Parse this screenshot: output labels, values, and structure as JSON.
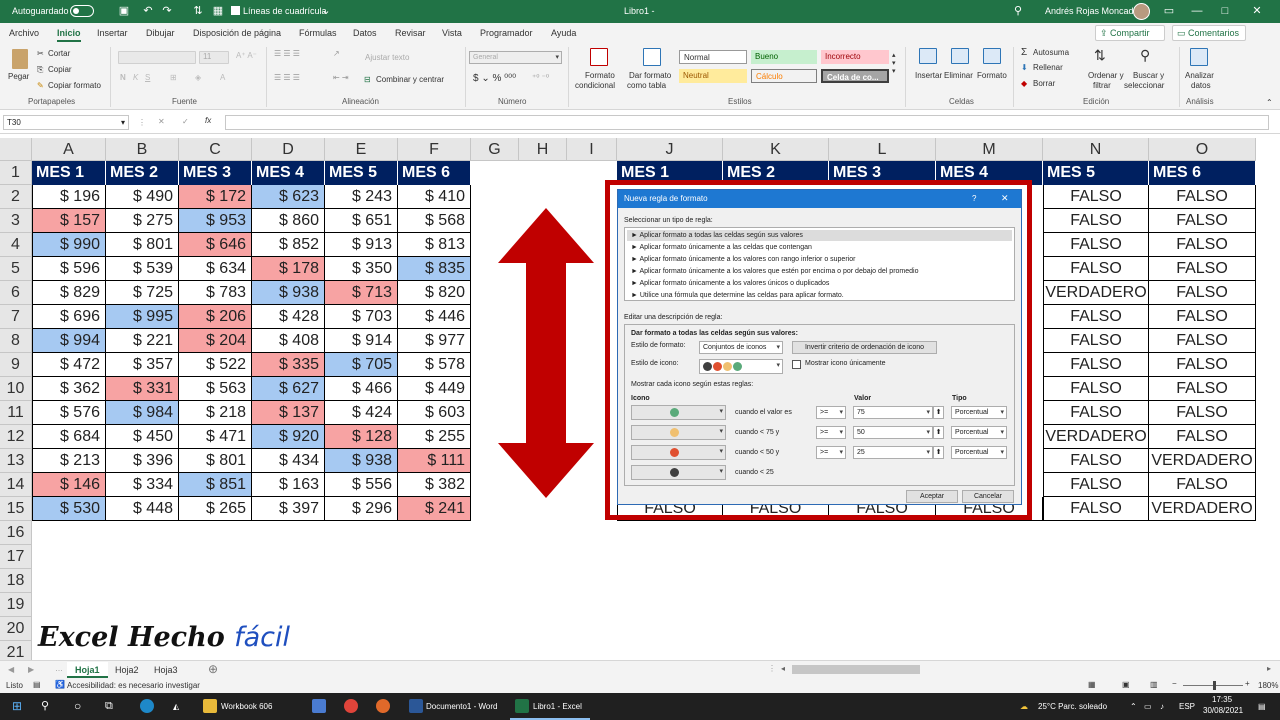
{
  "titlebar": {
    "autosave": "Autoguardado",
    "gridlines": "Líneas de cuadrícula",
    "doc": "Libro1 -",
    "user": "Andrés Rojas Moncada"
  },
  "menu": {
    "tabs": [
      "Archivo",
      "Inicio",
      "Insertar",
      "Dibujar",
      "Disposición de página",
      "Fórmulas",
      "Datos",
      "Revisar",
      "Vista",
      "Programador",
      "Ayuda"
    ],
    "share": "Compartir",
    "comments": "Comentarios"
  },
  "ribbon": {
    "portapapeles": {
      "paste": "Pegar",
      "cut": "Cortar",
      "copy": "Copiar",
      "format": "Copiar formato",
      "group": "Portapapeles"
    },
    "fuente": {
      "group": "Fuente",
      "size": "11"
    },
    "alineacion": {
      "wrap": "Ajustar texto",
      "merge": "Combinar y centrar",
      "group": "Alineación"
    },
    "numero": {
      "format": "General",
      "group": "Número"
    },
    "estilos": {
      "cond1": "Formato",
      "cond2": "condicional",
      "tbl1": "Dar formato",
      "tbl2": "como tabla",
      "normal": "Normal",
      "bueno": "Bueno",
      "incorrecto": "Incorrecto",
      "neutral": "Neutral",
      "calculo": "Cálculo",
      "celda": "Celda de co...",
      "group": "Estilos"
    },
    "celdas": {
      "insert": "Insertar",
      "delete": "Eliminar",
      "format": "Formato",
      "group": "Celdas"
    },
    "edicion": {
      "autosum": "Autosuma",
      "fill": "Rellenar",
      "clear": "Borrar",
      "sort1": "Ordenar y",
      "sort2": "filtrar",
      "find1": "Buscar y",
      "find2": "seleccionar",
      "group": "Edición"
    },
    "analisis": {
      "l1": "Analizar",
      "l2": "datos",
      "group": "Análisis"
    }
  },
  "formula": {
    "namebox": "T30",
    "fx": "fx"
  },
  "columns": [
    "A",
    "B",
    "C",
    "D",
    "E",
    "F",
    "G",
    "H",
    "I",
    "J",
    "K",
    "L",
    "M",
    "N",
    "O"
  ],
  "rows": [
    "1",
    "2",
    "3",
    "4",
    "5",
    "6",
    "7",
    "8",
    "9",
    "10",
    "11",
    "12",
    "13",
    "14",
    "15",
    "16",
    "17",
    "18",
    "19",
    "20",
    "21"
  ],
  "left_headers": [
    "MES 1",
    "MES 2",
    "MES 3",
    "MES 4",
    "MES 5",
    "MES 6"
  ],
  "right_headers": [
    "MES 1",
    "MES 2",
    "MES 3",
    "MES 4",
    "MES 5",
    "MES 6"
  ],
  "left_values": [
    [
      "$ 196",
      "$ 490",
      "$ 172",
      "$ 623",
      "$ 243",
      "$ 410"
    ],
    [
      "$ 157",
      "$ 275",
      "$ 953",
      "$ 860",
      "$ 651",
      "$ 568"
    ],
    [
      "$ 990",
      "$ 801",
      "$ 646",
      "$ 852",
      "$ 913",
      "$ 813"
    ],
    [
      "$ 596",
      "$ 539",
      "$ 634",
      "$ 178",
      "$ 350",
      "$ 835"
    ],
    [
      "$ 829",
      "$ 725",
      "$ 783",
      "$ 938",
      "$ 713",
      "$ 820"
    ],
    [
      "$ 696",
      "$ 995",
      "$ 206",
      "$ 428",
      "$ 703",
      "$ 446"
    ],
    [
      "$ 994",
      "$ 221",
      "$ 204",
      "$ 408",
      "$ 914",
      "$ 977"
    ],
    [
      "$ 472",
      "$ 357",
      "$ 522",
      "$ 335",
      "$ 705",
      "$ 578"
    ],
    [
      "$ 362",
      "$ 331",
      "$ 563",
      "$ 627",
      "$ 466",
      "$ 449"
    ],
    [
      "$ 576",
      "$ 984",
      "$ 218",
      "$ 137",
      "$ 424",
      "$ 603"
    ],
    [
      "$ 684",
      "$ 450",
      "$ 471",
      "$ 920",
      "$ 128",
      "$ 255"
    ],
    [
      "$ 213",
      "$ 396",
      "$ 801",
      "$ 434",
      "$ 938",
      "$ 111"
    ],
    [
      "$ 146",
      "$ 334",
      "$ 851",
      "$ 163",
      "$ 556",
      "$ 382"
    ],
    [
      "$ 530",
      "$ 448",
      "$ 265",
      "$ 397",
      "$ 296",
      "$ 241"
    ]
  ],
  "left_fills": [
    [
      "",
      "",
      "red",
      "blue",
      "",
      ""
    ],
    [
      "red",
      "",
      "blue",
      "",
      "",
      ""
    ],
    [
      "blue",
      "",
      "red",
      "",
      "",
      ""
    ],
    [
      "",
      "",
      "",
      "red",
      "",
      "blue"
    ],
    [
      "",
      "",
      "",
      "blue",
      "red",
      ""
    ],
    [
      "",
      "blue",
      "red",
      "",
      "",
      ""
    ],
    [
      "blue",
      "",
      "red",
      "",
      "",
      ""
    ],
    [
      "",
      "",
      "",
      "red",
      "blue",
      ""
    ],
    [
      "",
      "red",
      "",
      "blue",
      "",
      ""
    ],
    [
      "",
      "blue",
      "",
      "red",
      "",
      ""
    ],
    [
      "",
      "",
      "",
      "blue",
      "red",
      ""
    ],
    [
      "",
      "",
      "",
      "",
      "blue",
      "red"
    ],
    [
      "red",
      "",
      "blue",
      "",
      "",
      ""
    ],
    [
      "blue",
      "",
      "",
      "",
      "",
      "red"
    ]
  ],
  "right_values_N": [
    "FALSO",
    "FALSO",
    "FALSO",
    "FALSO",
    "VERDADERO",
    "FALSO",
    "FALSO",
    "FALSO",
    "FALSO",
    "FALSO",
    "VERDADERO",
    "FALSO",
    "FALSO",
    "FALSO"
  ],
  "right_values_O": [
    "FALSO",
    "FALSO",
    "FALSO",
    "FALSO",
    "FALSO",
    "FALSO",
    "FALSO",
    "FALSO",
    "FALSO",
    "FALSO",
    "FALSO",
    "VERDADERO",
    "FALSO",
    "VERDADERO"
  ],
  "row15_visible": [
    "FALSO",
    "FALSO",
    "FALSO",
    "FALSO"
  ],
  "dialog": {
    "title": "Nueva regla de formato",
    "help": "?",
    "select_label": "Seleccionar un tipo de regla:",
    "rules": [
      "Aplicar formato a todas las celdas según sus valores",
      "Aplicar formato únicamente a las celdas que contengan",
      "Aplicar formato únicamente a los valores con rango inferior o superior",
      "Aplicar formato únicamente a los valores que estén por encima o por debajo del promedio",
      "Aplicar formato únicamente a los valores únicos o duplicados",
      "Utilice una fórmula que determine las celdas para aplicar formato."
    ],
    "edit_label": "Editar una descripción de regla:",
    "desc_bold": "Dar formato a todas las celdas según sus valores:",
    "style_label": "Estilo de formato:",
    "style_value": "Conjuntos de iconos",
    "reverse_btn": "Invertir criterio de ordenación de icono",
    "icon_style_label": "Estilo de icono:",
    "show_icon_only": "Mostrar icono únicamente",
    "rules_label": "Mostrar cada icono según estas reglas:",
    "col_icon": "Icono",
    "col_value": "Valor",
    "col_type": "Tipo",
    "conds": [
      {
        "text": "cuando el valor es",
        "op": ">=",
        "value": "75",
        "type": "Porcentual",
        "color": "#5aaa7a"
      },
      {
        "text": "cuando < 75 y",
        "op": ">=",
        "value": "50",
        "type": "Porcentual",
        "color": "#f0c070"
      },
      {
        "text": "cuando < 50 y",
        "op": ">=",
        "value": "25",
        "type": "Porcentual",
        "color": "#e05030"
      },
      {
        "text": "cuando < 25",
        "op": "",
        "value": "",
        "type": "",
        "color": "#404040"
      }
    ],
    "accept": "Aceptar",
    "cancel": "Cancelar"
  },
  "sheets": [
    "Hoja1",
    "Hoja2",
    "Hoja3"
  ],
  "status": {
    "ready": "Listo",
    "accessibility": "Accesibilidad: es necesario investigar",
    "zoom": "180%"
  },
  "taskbar": {
    "workbook": "Workbook 606",
    "word": "Documento1 - Word",
    "excel": "Libro1 - Excel",
    "weather": "25°C  Parc. soleado",
    "lang": "ESP",
    "time": "17:35",
    "date": "30/08/2021"
  },
  "logo": {
    "main": "Excel Hecho ",
    "accent": "fácil"
  },
  "colors": {
    "header_bg": "#002060",
    "red_fill": "#f7a3a3",
    "blue_fill": "#a6c9f2",
    "frame": "#c00000",
    "arrow": "#c00000",
    "excel_green": "#217346"
  }
}
